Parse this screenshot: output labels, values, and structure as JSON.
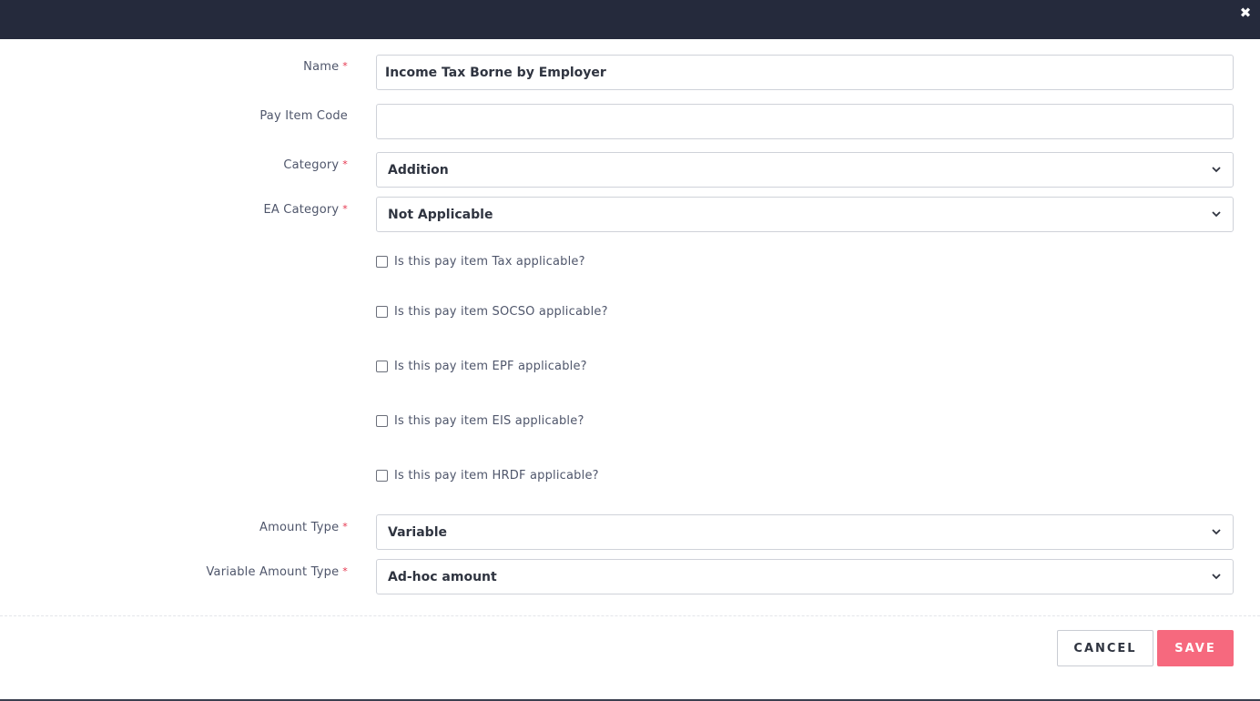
{
  "header": {
    "close_icon": "close-icon",
    "background": "#252a3c"
  },
  "form": {
    "name": {
      "label": "Name",
      "required": "*",
      "value": "Income Tax Borne by Employer"
    },
    "pay_item_code": {
      "label": "Pay Item Code",
      "value": "",
      "placeholder": ""
    },
    "category": {
      "label": "Category",
      "required": "*",
      "value": "Addition"
    },
    "ea_category": {
      "label": "EA Category",
      "required": "*",
      "value": "Not Applicable"
    },
    "checkboxes": [
      {
        "label": "Is this pay item Tax applicable?",
        "checked": false
      },
      {
        "label": "Is this pay item SOCSO applicable?",
        "checked": false
      },
      {
        "label": "Is this pay item EPF applicable?",
        "checked": false
      },
      {
        "label": "Is this pay item EIS applicable?",
        "checked": false
      },
      {
        "label": "Is this pay item HRDF applicable?",
        "checked": false
      }
    ],
    "amount_type": {
      "label": "Amount Type",
      "required": "*",
      "value": "Variable"
    },
    "variable_amount_type": {
      "label": "Variable Amount Type",
      "required": "*",
      "value": "Ad-hoc amount"
    }
  },
  "footer": {
    "cancel_label": "CANCEL",
    "save_label": "SAVE"
  },
  "colors": {
    "accent": "#f6697e",
    "required": "#e5334b"
  }
}
